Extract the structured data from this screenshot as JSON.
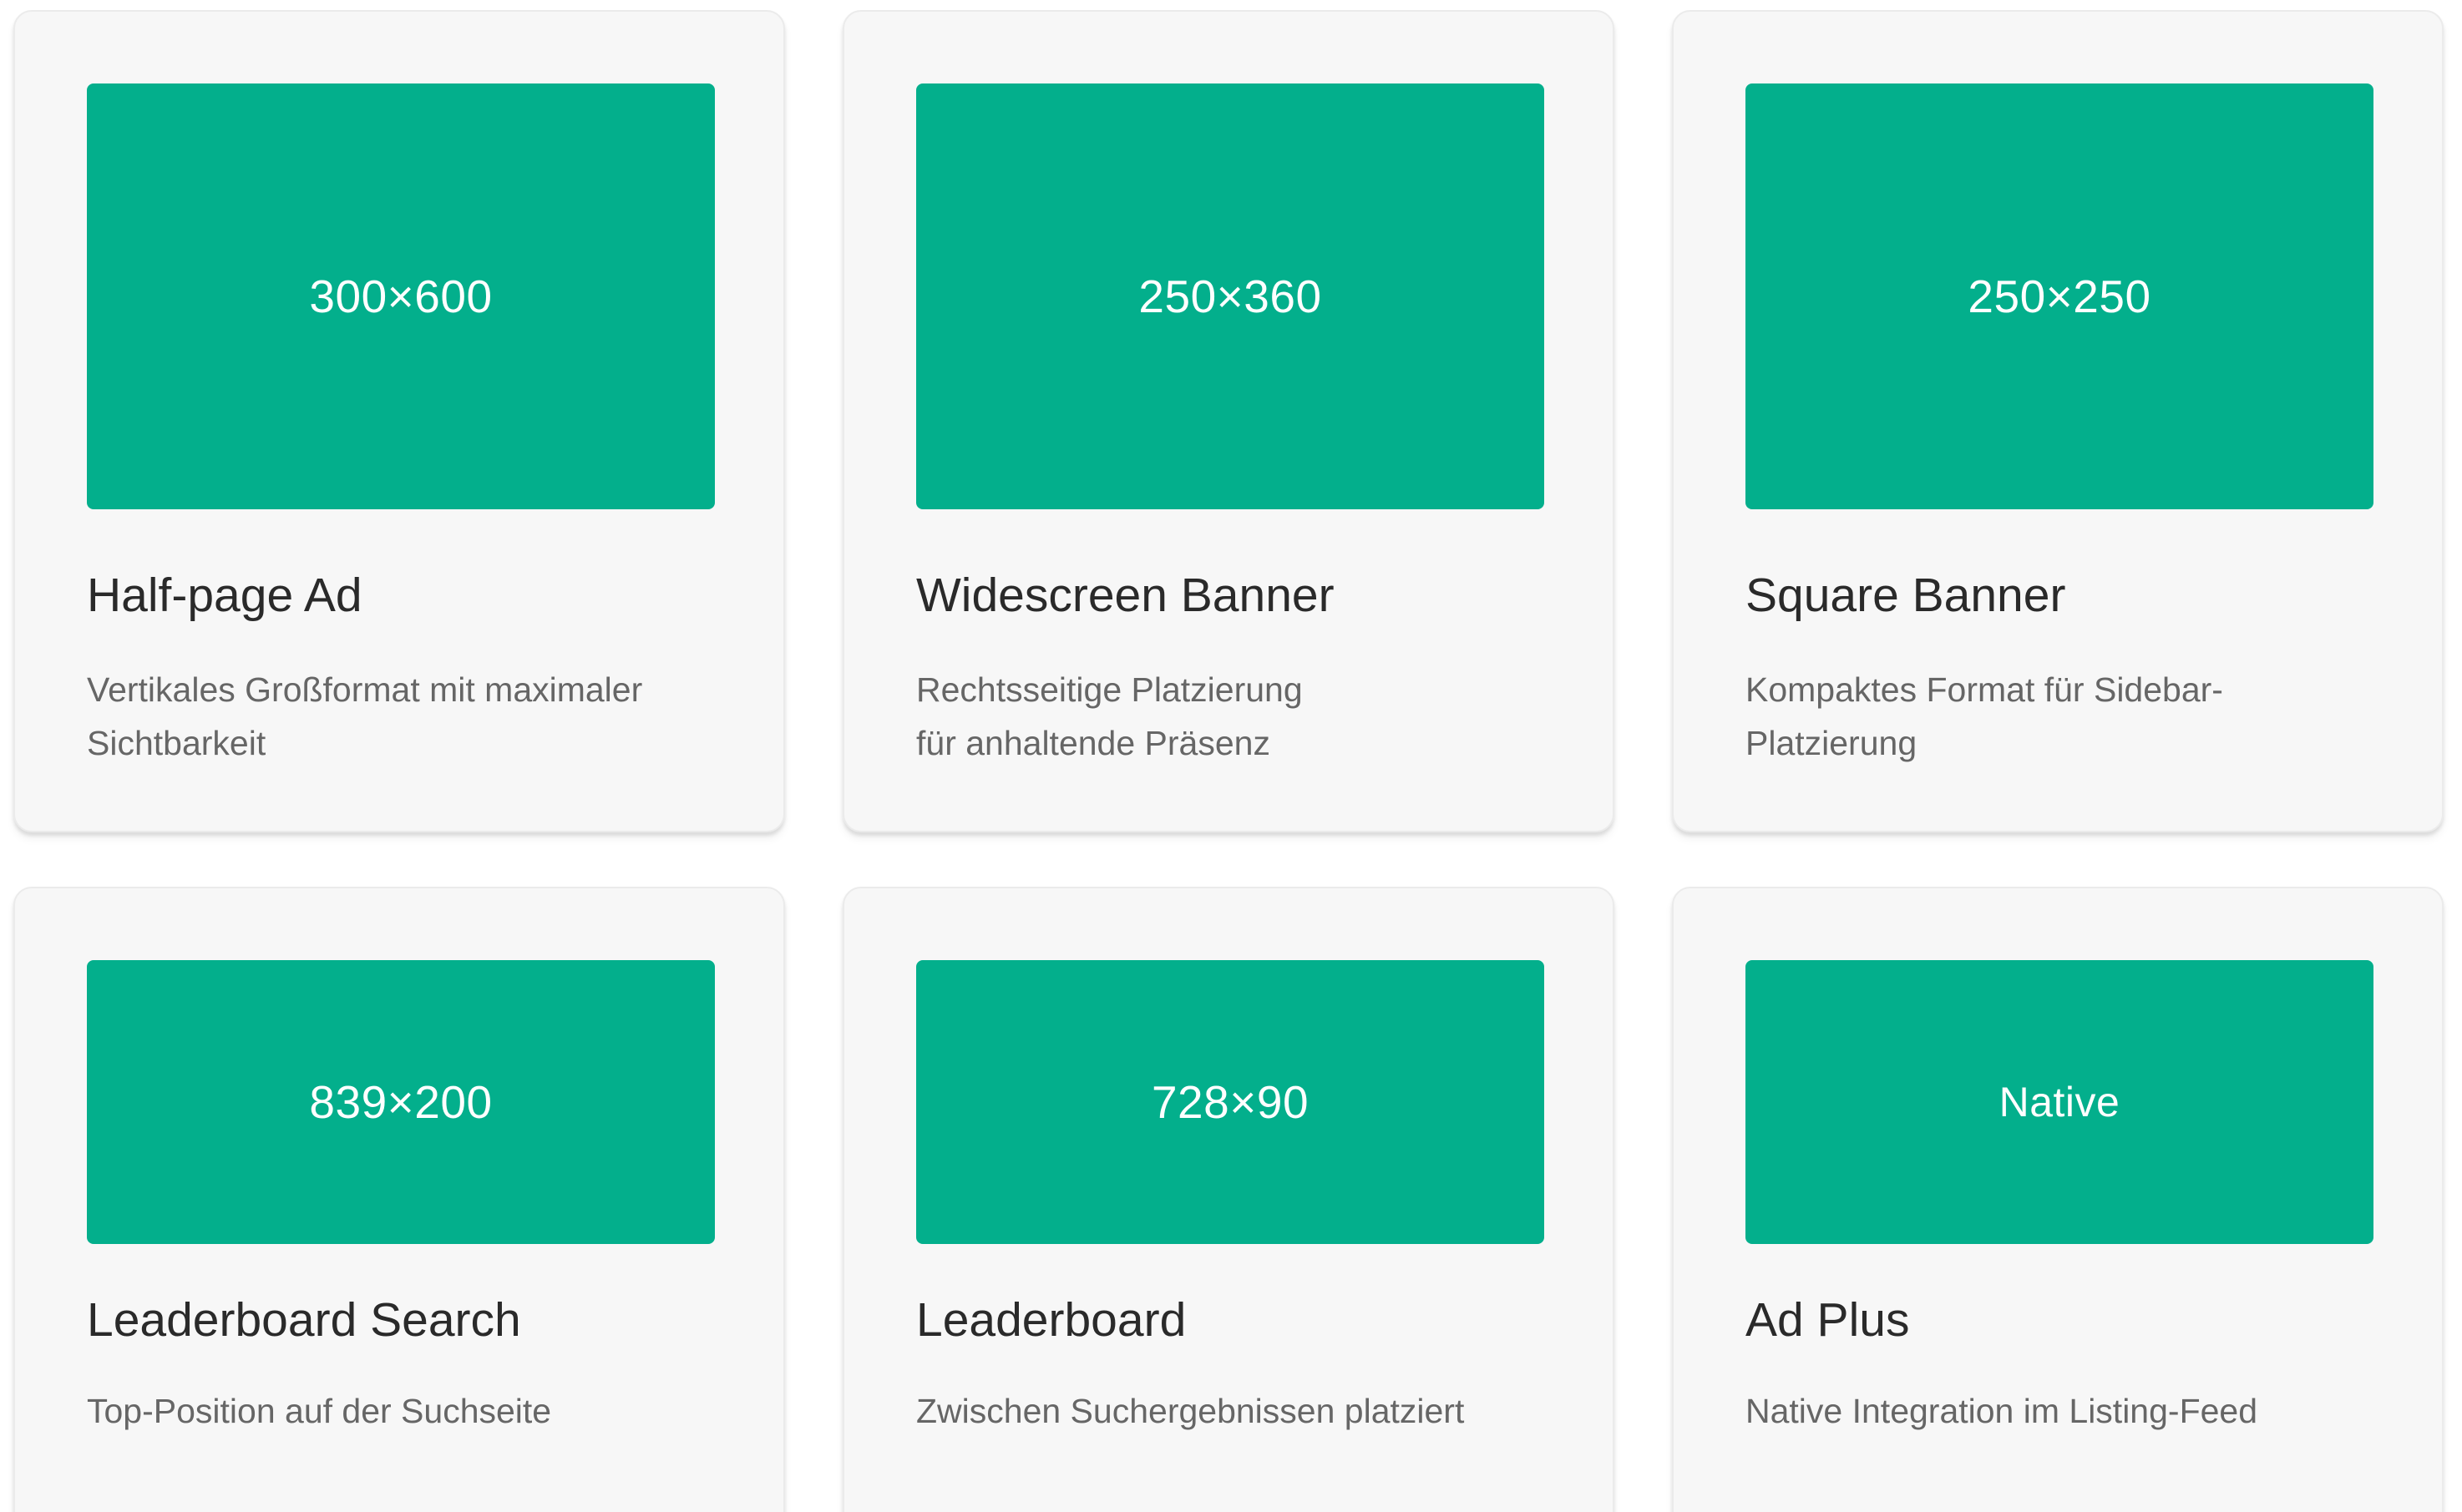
{
  "accent_color": "#03af8c",
  "cards": [
    {
      "size": "300×600",
      "title": "Half-page Ad",
      "description_lines": [
        "Vertikales Großformat mit maximaler",
        "Sichtbarkeit"
      ]
    },
    {
      "size": "250×360",
      "title": "Widescreen Banner",
      "description_lines": [
        "Rechtsseitige Platzierung",
        "für anhaltende Präsenz"
      ]
    },
    {
      "size": "250×250",
      "title": "Square Banner",
      "description_lines": [
        "Kompaktes Format für Sidebar-",
        "Platzierung"
      ]
    },
    {
      "size": "839×200",
      "title": "Leaderboard Search",
      "description_lines": [
        "Top-Position auf der Suchseite"
      ]
    },
    {
      "size": "728×90",
      "title": "Leaderboard",
      "description_lines": [
        "Zwischen Suchergebnissen platziert"
      ]
    },
    {
      "size": "Native",
      "title": "Ad Plus",
      "description_lines": [
        "Native Integration im Listing-Feed"
      ]
    }
  ]
}
